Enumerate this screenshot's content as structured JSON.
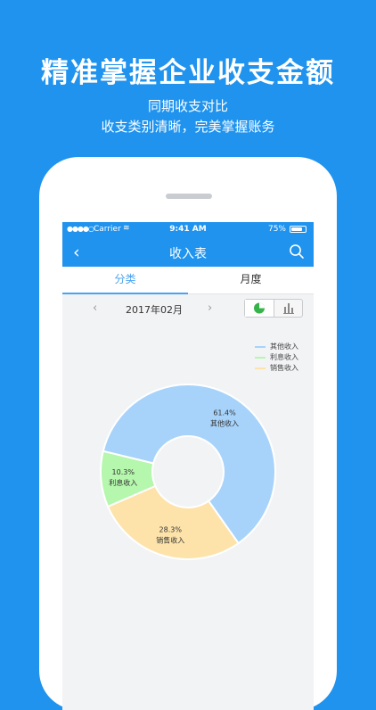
{
  "promo": {
    "headline": "精准掌握企业收支金额",
    "sub1": "同期收支对比",
    "sub2": "收支类别清晰，完美掌握账务"
  },
  "status_bar": {
    "signal": "●●●●○",
    "carrier": "Carrier",
    "wifi": "≋",
    "time": "9:41 AM",
    "battery": "75%"
  },
  "navbar": {
    "back": "‹",
    "title": "收入表"
  },
  "tabs": [
    {
      "label": "分类",
      "active": true
    },
    {
      "label": "月度",
      "active": false
    }
  ],
  "month_selector": {
    "prev": "‹",
    "month": "2017年02月",
    "next": "›"
  },
  "colors": {
    "brand": "#1f93ee",
    "other_income": "#a7d3fb",
    "interest_income": "#b5f7ad",
    "sales_income": "#fde3aa",
    "toggle_pie": "#36b44a"
  },
  "chart_data": {
    "type": "pie",
    "donut": true,
    "legend_position": "top-right",
    "series": [
      {
        "name": "其他收入",
        "value": 61.4,
        "label": "61.4%",
        "color": "#a7d3fb"
      },
      {
        "name": "利息收入",
        "value": 10.3,
        "label": "10.3%",
        "color": "#b5f7ad"
      },
      {
        "name": "销售收入",
        "value": 28.3,
        "label": "28.3%",
        "color": "#fde3aa"
      }
    ]
  }
}
